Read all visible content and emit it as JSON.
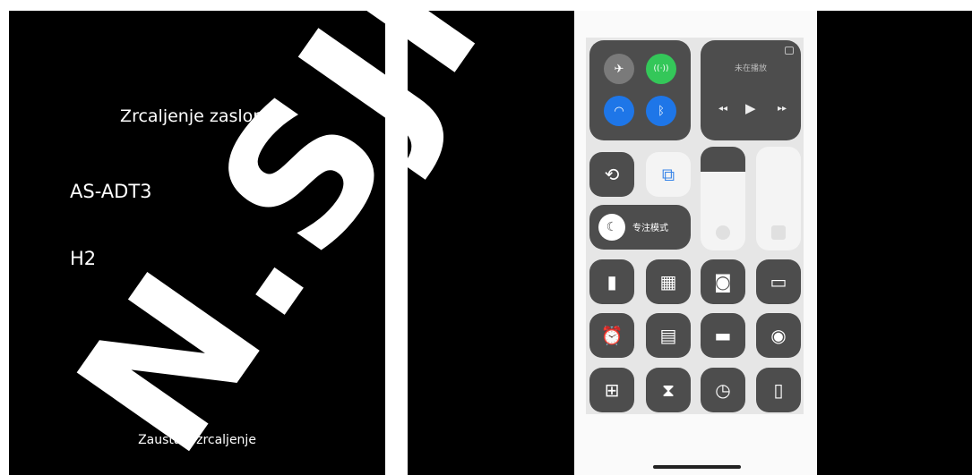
{
  "mirroring": {
    "title": "Zrcaljenje zaslona",
    "devices": [
      "AS-ADT3",
      "H2"
    ],
    "stop_label": "Zaustavi zrcaljenje"
  },
  "watermark": {
    "text": "N.SJI",
    "color": "#ffffff"
  },
  "control_center": {
    "now_playing_label": "未在播放",
    "focus_label": "专注模式",
    "media_controls": {
      "prev": "◂◂",
      "play": "▶",
      "next": "▸▸"
    },
    "connectivity": [
      {
        "icon": "airplane-icon",
        "glyph": "✈",
        "color": "#7a7a7a"
      },
      {
        "icon": "cellular-icon",
        "glyph": "((·))",
        "color": "#34c759"
      },
      {
        "icon": "wifi-icon",
        "glyph": "◠",
        "color": "#1e76e8"
      },
      {
        "icon": "bluetooth-icon",
        "glyph": "ᛒ",
        "color": "#1e76e8"
      }
    ],
    "toggles": [
      {
        "icon": "orientation-lock-icon",
        "glyph": "⟲"
      },
      {
        "icon": "screen-mirroring-icon",
        "glyph": "⧉"
      }
    ],
    "grid": [
      {
        "icon": "flashlight-icon",
        "glyph": "▮"
      },
      {
        "icon": "calculator-icon",
        "glyph": "▦"
      },
      {
        "icon": "camera-icon",
        "glyph": "◙"
      },
      {
        "icon": "battery-icon",
        "glyph": "▭"
      },
      {
        "icon": "alarm-icon",
        "glyph": "⏰"
      },
      {
        "icon": "notes-icon",
        "glyph": "▤"
      },
      {
        "icon": "wallet-icon",
        "glyph": "▬"
      },
      {
        "icon": "screen-record-icon",
        "glyph": "◉"
      },
      {
        "icon": "code-scanner-icon",
        "glyph": "⊞"
      },
      {
        "icon": "voice-memo-icon",
        "glyph": "⧗"
      },
      {
        "icon": "timer-icon",
        "glyph": "◷"
      },
      {
        "icon": "remote-icon",
        "glyph": "▯"
      }
    ],
    "colors": {
      "dark_tile": "#4d4d4d",
      "light_tile": "#f4f4f4",
      "background": "#e6e6e6"
    }
  }
}
